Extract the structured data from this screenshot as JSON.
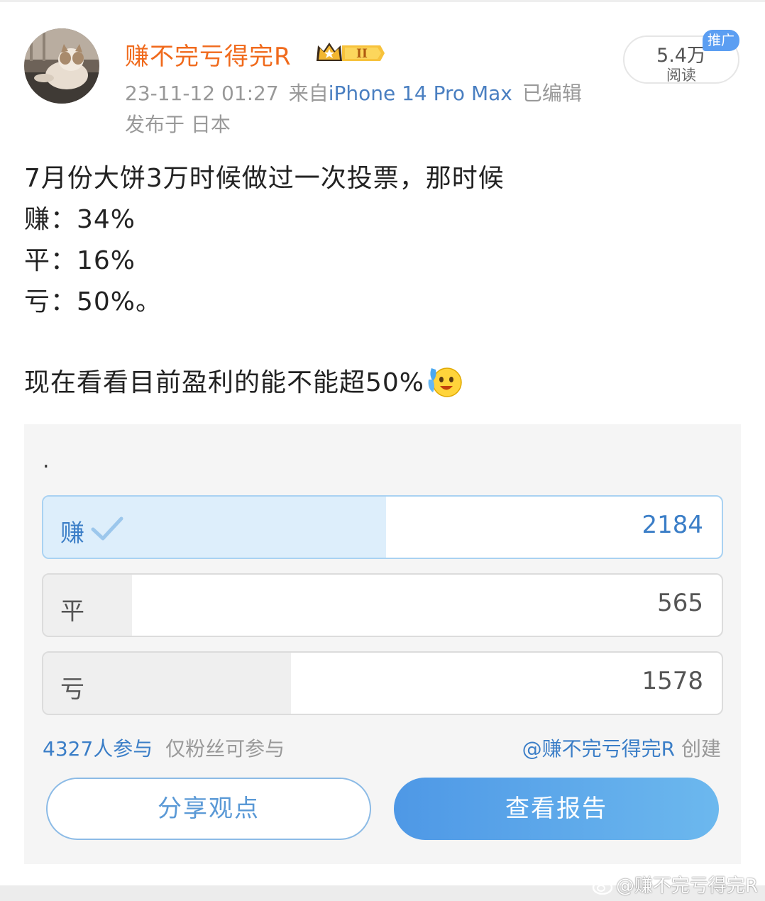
{
  "post": {
    "username": "赚不完亏得完R",
    "timestamp": "23-11-12 01:27",
    "source_prefix": "来自",
    "device": "iPhone 14 Pro Max",
    "edited": "已编辑",
    "location": "发布于 日本",
    "reads_count": "5.4万",
    "reads_label": "阅读",
    "promo_tag": "推广",
    "vip_level": "II",
    "lines": [
      "7月份大饼3万时候做过一次投票，那时候",
      "赚：34%",
      "平：16%",
      "亏：50%。",
      "现在看看目前盈利的能不能超50%"
    ],
    "emoji": "crying-laughing-emoji"
  },
  "poll": {
    "title": ".",
    "options": [
      {
        "label": "赚",
        "votes": "2184",
        "share": 0.505,
        "selected": true
      },
      {
        "label": "平",
        "votes": "565",
        "share": 0.131,
        "selected": false
      },
      {
        "label": "亏",
        "votes": "1578",
        "share": 0.365,
        "selected": false
      }
    ],
    "participants": "4327人参与",
    "restriction": "仅粉丝可参与",
    "creator_mention": "@赚不完亏得完R",
    "creator_suffix": "创建",
    "share_button": "分享观点",
    "report_button": "查看报告"
  },
  "watermark": "@赚不完亏得完R",
  "colors": {
    "username": "#f06a1c",
    "link_blue": "#3b7ec7",
    "selected_fill": "#ddeefb",
    "primary_button": "#5aa8ea"
  }
}
